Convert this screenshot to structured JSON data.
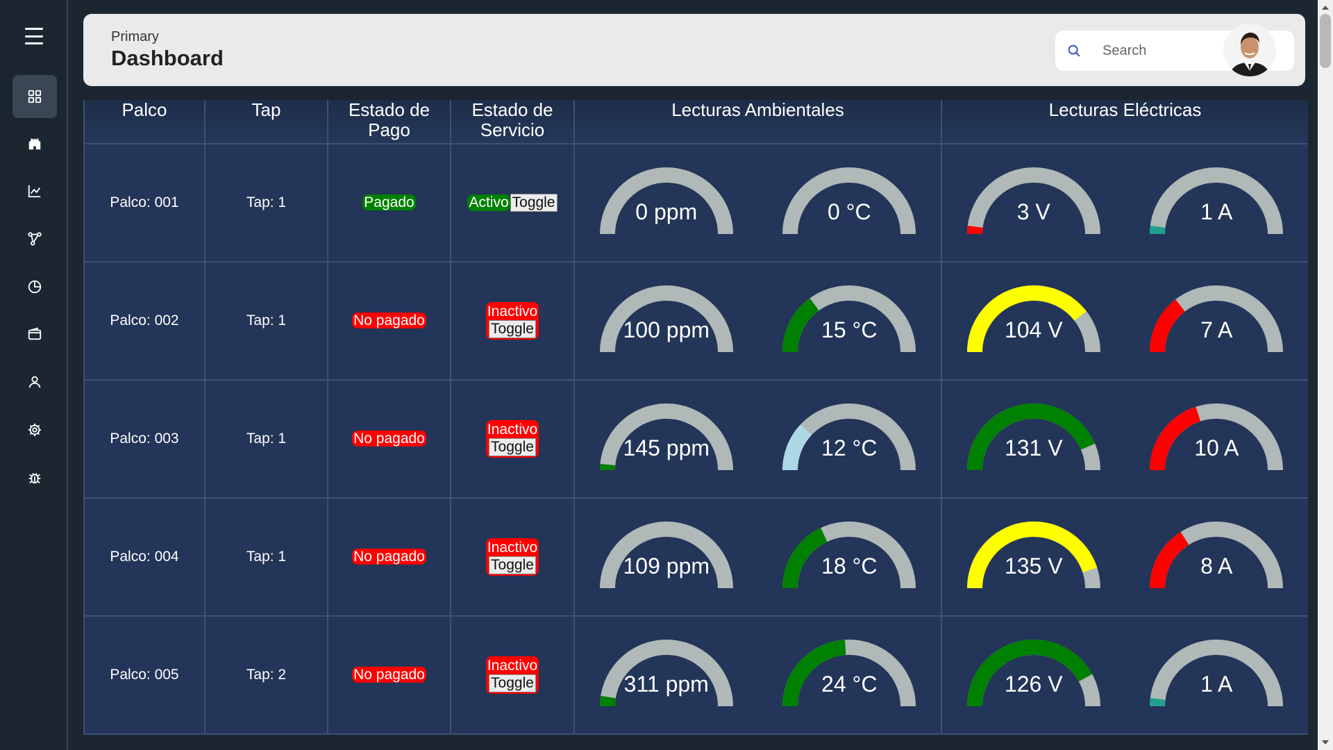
{
  "header": {
    "breadcrumb": "Primary",
    "title": "Dashboard",
    "search_placeholder": "Search"
  },
  "sidebar": {
    "items": [
      {
        "icon": "grid-icon",
        "label": "dashboard",
        "active": true
      },
      {
        "icon": "building-icon",
        "label": "palcos"
      },
      {
        "icon": "chart-line-icon",
        "label": "analytics"
      },
      {
        "icon": "network-icon",
        "label": "connections"
      },
      {
        "icon": "pie-chart-icon",
        "label": "reports"
      },
      {
        "icon": "wallet-icon",
        "label": "payments"
      },
      {
        "icon": "user-icon",
        "label": "users"
      },
      {
        "icon": "gear-icon",
        "label": "settings"
      },
      {
        "icon": "bug-icon",
        "label": "debug"
      }
    ]
  },
  "table": {
    "columns": [
      "Palco",
      "Tap",
      "Estado de Pago",
      "Estado de Servicio",
      "Lecturas Ambientales",
      "Lecturas Eléctricas"
    ],
    "col_palco": "Palco",
    "col_tap": "Tap",
    "col_pago_1": "Estado de",
    "col_pago_2": "Pago",
    "col_servicio_1": "Estado de",
    "col_servicio_2": "Servicio",
    "col_amb": "Lecturas Ambientales",
    "col_elec": "Lecturas Eléctricas",
    "toggle_label": "Toggle",
    "rows": [
      {
        "palco": "Palco: 001",
        "tap": "Tap: 1",
        "pago": "Pagado",
        "pago_ok": true,
        "servicio": "Activo",
        "servicio_ok": true,
        "ppm": "0 ppm",
        "ppm_frac": 0.0,
        "ppm_color": "#008000",
        "temp": "0 °C",
        "temp_frac": 0.0,
        "temp_color": "#add8e6",
        "volt": "3 V",
        "volt_frac": 0.04,
        "volt_color": "#ff0000",
        "amp": "1 A",
        "amp_frac": 0.04,
        "amp_color": "#20a090"
      },
      {
        "palco": "Palco: 002",
        "tap": "Tap: 1",
        "pago": "No pagado",
        "pago_ok": false,
        "servicio": "Inactivo",
        "servicio_ok": false,
        "ppm": "100 ppm",
        "ppm_frac": 0.0,
        "ppm_color": "#008000",
        "temp": "15 °C",
        "temp_frac": 0.3,
        "temp_color": "#008000",
        "volt": "104 V",
        "volt_frac": 0.79,
        "volt_color": "#ffff00",
        "amp": "7 A",
        "amp_frac": 0.29,
        "amp_color": "#ff0000"
      },
      {
        "palco": "Palco: 003",
        "tap": "Tap: 1",
        "pago": "No pagado",
        "pago_ok": false,
        "servicio": "Inactivo",
        "servicio_ok": false,
        "ppm": "145 ppm",
        "ppm_frac": 0.03,
        "ppm_color": "#008000",
        "temp": "12 °C",
        "temp_frac": 0.24,
        "temp_color": "#add8e6",
        "volt": "131 V",
        "volt_frac": 0.87,
        "volt_color": "#008000",
        "amp": "10 A",
        "amp_frac": 0.4,
        "amp_color": "#ff0000"
      },
      {
        "palco": "Palco: 004",
        "tap": "Tap: 1",
        "pago": "No pagado",
        "pago_ok": false,
        "servicio": "Inactivo",
        "servicio_ok": false,
        "ppm": "109 ppm",
        "ppm_frac": 0.0,
        "ppm_color": "#008000",
        "temp": "18 °C",
        "temp_frac": 0.36,
        "temp_color": "#008000",
        "volt": "135 V",
        "volt_frac": 0.9,
        "volt_color": "#ffff00",
        "amp": "8 A",
        "amp_frac": 0.32,
        "amp_color": "#ff0000"
      },
      {
        "palco": "Palco: 005",
        "tap": "Tap: 2",
        "pago": "No pagado",
        "pago_ok": false,
        "servicio": "Inactivo",
        "servicio_ok": false,
        "ppm": "311 ppm",
        "ppm_frac": 0.05,
        "ppm_color": "#008000",
        "temp": "24 °C",
        "temp_frac": 0.48,
        "temp_color": "#008000",
        "volt": "126 V",
        "volt_frac": 0.84,
        "volt_color": "#008000",
        "amp": "1 A",
        "amp_frac": 0.04,
        "amp_color": "#20a090"
      }
    ]
  },
  "colors": {
    "sidebar_bg": "#1b2631",
    "cell_bg": "#233558",
    "gauge_track": "#b0b8b8",
    "ok": "#008000",
    "bad": "#ff0000"
  }
}
